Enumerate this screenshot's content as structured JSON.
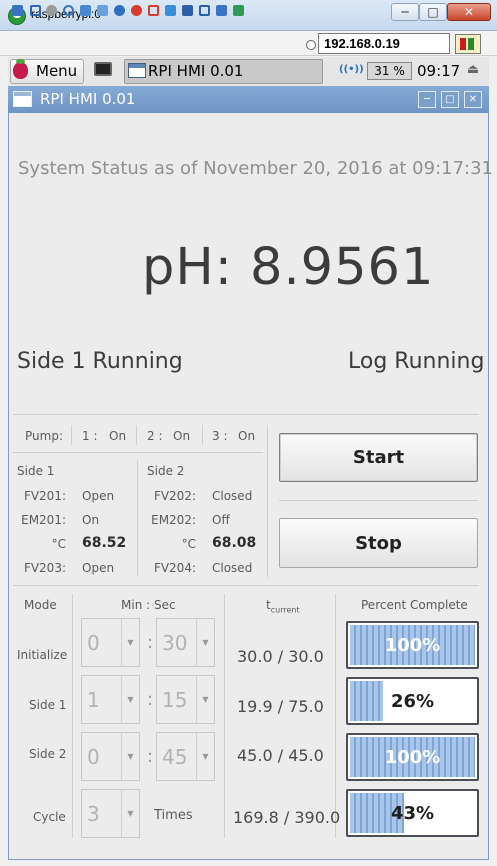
{
  "vnc": {
    "title": "raspberrypi:0",
    "host": "192.168.0.19",
    "minimize": "─",
    "maximize": "□",
    "close": "✕"
  },
  "taskbar": {
    "menu_label": "Menu",
    "task_label": "RPI HMI 0.01",
    "cpu": "31 %",
    "clock": "09:17",
    "wifi_glyph": "((•))",
    "eject_glyph": "⏏"
  },
  "hmi": {
    "title": "RPI HMI 0.01",
    "status": "System Status as of November 20, 2016 at 09:17:31",
    "ph_label": "pH:",
    "ph_value": "8.9561",
    "side_running": "Side 1 Running",
    "log_running": "Log Running",
    "pump": {
      "label": "Pump:",
      "items": [
        {
          "num": "1 :",
          "state": "On"
        },
        {
          "num": "2 :",
          "state": "On"
        },
        {
          "num": "3 :",
          "state": "On"
        }
      ]
    },
    "side1": {
      "heading": "Side 1",
      "rows": [
        {
          "label": "FV201:",
          "value": "Open"
        },
        {
          "label": "EM201:",
          "value": "On"
        },
        {
          "label": "°C",
          "value": "68.52"
        },
        {
          "label": "FV203:",
          "value": "Open"
        }
      ]
    },
    "side2": {
      "heading": "Side 2",
      "rows": [
        {
          "label": "FV202:",
          "value": "Closed"
        },
        {
          "label": "EM202:",
          "value": "Off"
        },
        {
          "label": "°C",
          "value": "68.08"
        },
        {
          "label": "FV204:",
          "value": "Closed"
        }
      ]
    },
    "start_label": "Start",
    "stop_label": "Stop",
    "table": {
      "mode_header": "Mode",
      "minsec_header": "Min : Sec",
      "t_header_main": "t",
      "t_header_sub": "current",
      "pct_header": "Percent Complete",
      "times_label": "Times",
      "colon": ":",
      "rows": [
        {
          "mode": "Initialize",
          "min": "0",
          "sec": "30",
          "t": "30.0  /  30.0",
          "pct": "100%",
          "pct_value": 1.0
        },
        {
          "mode": "Side 1",
          "min": "1",
          "sec": "15",
          "t": "19.9  /  75.0",
          "pct": "26%",
          "pct_value": 0.26
        },
        {
          "mode": "Side 2",
          "min": "0",
          "sec": "45",
          "t": "45.0  /  45.0",
          "pct": "100%",
          "pct_value": 1.0
        },
        {
          "mode": "Cycle",
          "min": "3",
          "sec": "",
          "t": "169.8 / 390.0",
          "pct": "43%",
          "pct_value": 0.43
        }
      ]
    }
  },
  "colors": {
    "hmi_titlebar": "#7b9fcc",
    "progress_fill": "#89aede",
    "light_text": "#8f8f8f"
  }
}
